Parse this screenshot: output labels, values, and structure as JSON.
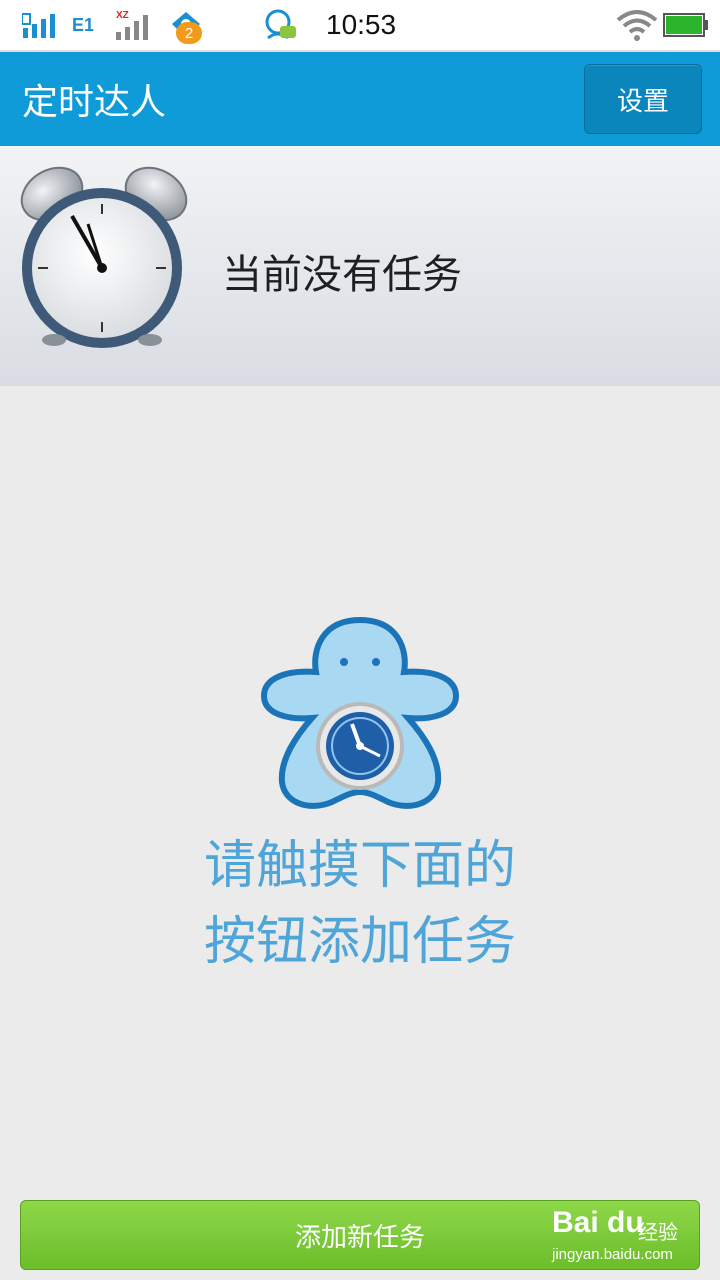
{
  "status_bar": {
    "time": "10:53",
    "network_label": "E1",
    "carrier_tag": "XZ",
    "notification_count": "2",
    "icons": [
      "signal-icon",
      "signal-icon",
      "notification-app-icon",
      "qq-icon",
      "wifi-icon",
      "battery-icon"
    ]
  },
  "app_bar": {
    "title": "定时达人",
    "settings_label": "设置"
  },
  "task_header": {
    "empty_message": "当前没有任务"
  },
  "empty_state": {
    "line1": "请触摸下面的",
    "line2": "按钮添加任务"
  },
  "footer": {
    "add_task_label": "添加新任务"
  },
  "watermark": {
    "brand": "Bai du",
    "brand_cn": "经验",
    "url": "jingyan.baidu.com"
  },
  "colors": {
    "app_bar": "#0e9bd8",
    "hint_text": "#4fa5d8",
    "add_button": "#7cc93a"
  }
}
